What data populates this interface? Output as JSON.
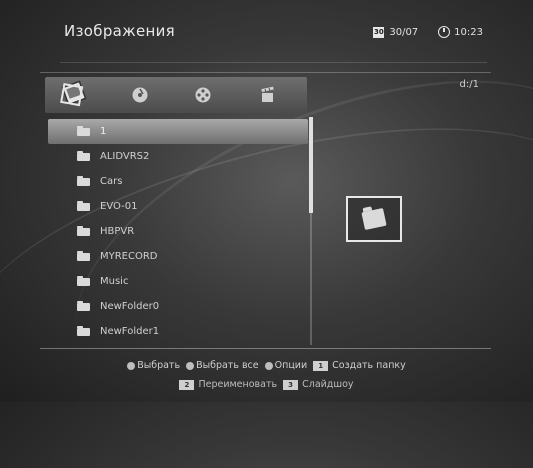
{
  "header": {
    "title": "Изображения",
    "date": "30/07",
    "date_icon_text": "30",
    "time": "10:23"
  },
  "tabs": [
    {
      "icon": "photo-icon",
      "active": true
    },
    {
      "icon": "music-disc-icon",
      "active": false
    },
    {
      "icon": "film-reel-icon",
      "active": false
    },
    {
      "icon": "clapperboard-icon",
      "active": false
    }
  ],
  "path": "d:/1",
  "file_list": [
    {
      "name": "1",
      "selected": true
    },
    {
      "name": "ALIDVRS2",
      "selected": false
    },
    {
      "name": "Cars",
      "selected": false
    },
    {
      "name": "EVO-01",
      "selected": false
    },
    {
      "name": "HBPVR",
      "selected": false
    },
    {
      "name": "MYRECORD",
      "selected": false
    },
    {
      "name": "Music",
      "selected": false
    },
    {
      "name": "NewFolder0",
      "selected": false
    },
    {
      "name": "NewFolder1",
      "selected": false
    }
  ],
  "footer": {
    "select": "Выбрать",
    "select_all": "Выбрать все",
    "options": "Опции",
    "key1": "1",
    "create_folder": "Создать папку",
    "key2": "2",
    "rename": "Переименовать",
    "key3": "3",
    "slideshow": "Слайдшоу"
  },
  "colors": {
    "selected_row": "#9a9a9a",
    "background": "#383838",
    "text": "#d6d6d6"
  }
}
